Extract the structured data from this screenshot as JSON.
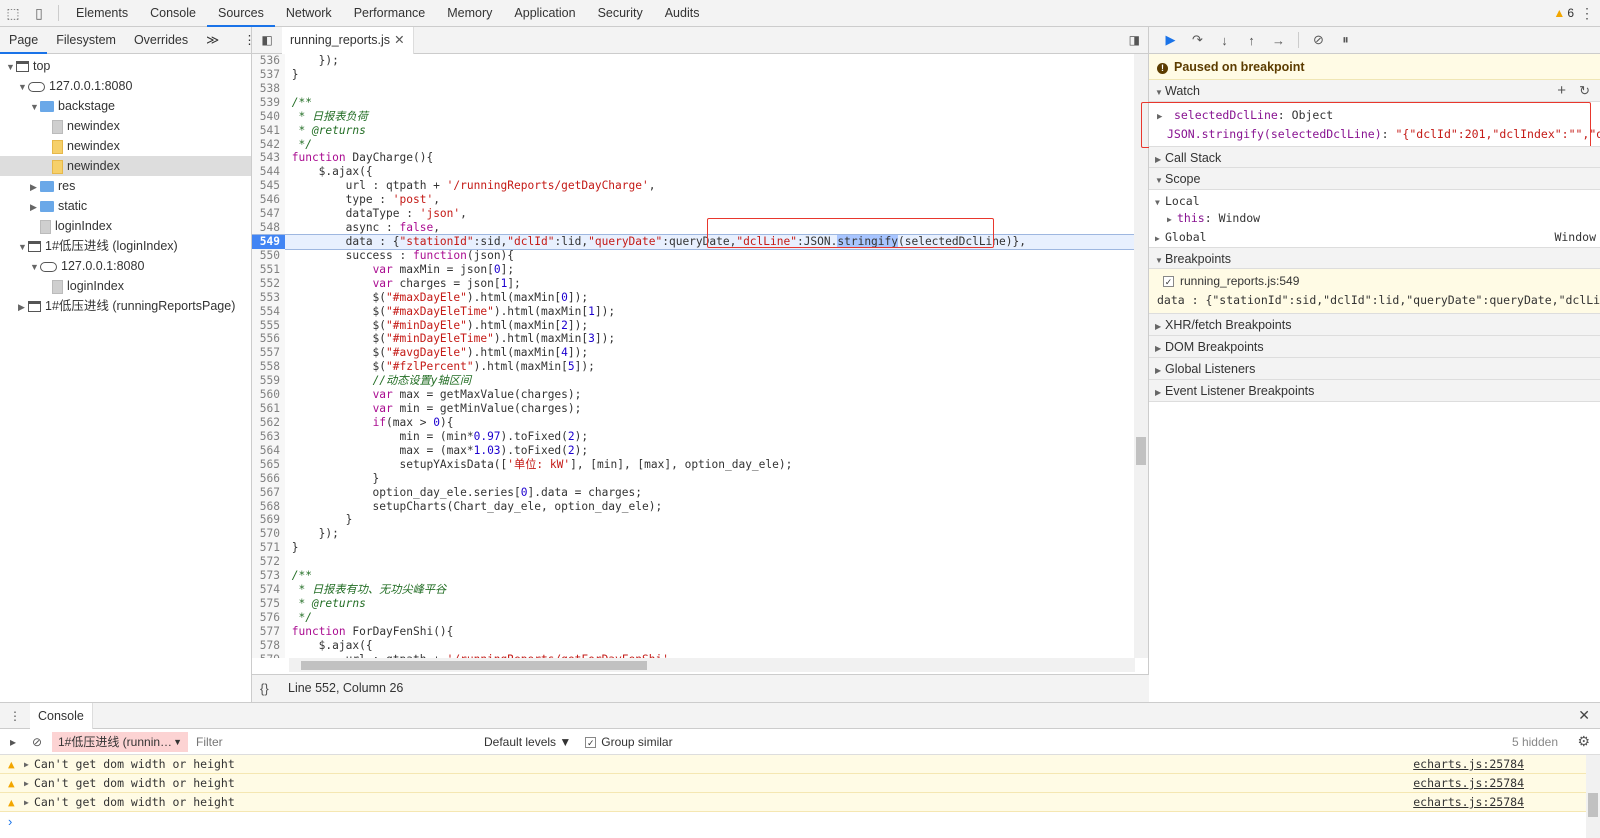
{
  "toolbar": {
    "tabs": [
      "Elements",
      "Console",
      "Sources",
      "Network",
      "Performance",
      "Memory",
      "Application",
      "Security",
      "Audits"
    ],
    "active_tab": "Sources",
    "warning_count": "6",
    "colors": {
      "accent": "#1a73e8",
      "warning": "#f2a600",
      "highlight_box": "#e8372d"
    }
  },
  "navigator": {
    "tabs": [
      "Page",
      "Filesystem",
      "Overrides"
    ],
    "more": "≫",
    "tree": [
      {
        "label": "top",
        "icon": "frame-icon",
        "depth": 0,
        "open": true
      },
      {
        "label": "127.0.0.1:8080",
        "icon": "cloud-icon",
        "depth": 1,
        "open": true
      },
      {
        "label": "backstage",
        "icon": "folder-icon",
        "depth": 2,
        "open": true
      },
      {
        "label": "newindex",
        "icon": "file-icon",
        "depth": 3
      },
      {
        "label": "newindex",
        "icon": "js-file-icon",
        "depth": 3
      },
      {
        "label": "newindex",
        "icon": "js-file-icon",
        "depth": 3,
        "selected": true
      },
      {
        "label": "res",
        "icon": "folder-icon",
        "depth": 2,
        "open": false
      },
      {
        "label": "static",
        "icon": "folder-icon",
        "depth": 2,
        "open": false
      },
      {
        "label": "loginIndex",
        "icon": "file-icon",
        "depth": 2
      },
      {
        "label": "1#低压进线 (loginIndex)",
        "icon": "frame-icon",
        "depth": 1,
        "open": true
      },
      {
        "label": "127.0.0.1:8080",
        "icon": "cloud-icon",
        "depth": 2,
        "open": true
      },
      {
        "label": "loginIndex",
        "icon": "file-icon",
        "depth": 3
      },
      {
        "label": "1#低压进线 (runningReportsPage)",
        "icon": "frame-icon",
        "depth": 1,
        "open": false
      }
    ]
  },
  "editor": {
    "file_tab": "running_reports.js",
    "status": "Line 552, Column 26",
    "format_button": "{}",
    "breakpoint_line": 549,
    "lines": [
      {
        "n": 536,
        "h": "    });"
      },
      {
        "n": 537,
        "h": "}"
      },
      {
        "n": 538,
        "h": ""
      },
      {
        "n": 539,
        "h": "<span class=\"cm\">/**</span>"
      },
      {
        "n": 540,
        "h": "<span class=\"cm\"> * 日报表负荷</span>"
      },
      {
        "n": 541,
        "h": "<span class=\"cm\"> * @returns</span>"
      },
      {
        "n": 542,
        "h": "<span class=\"cm\"> */</span>"
      },
      {
        "n": 543,
        "h": "<span class=\"kw\">function</span> DayCharge(){"
      },
      {
        "n": 544,
        "h": "    $.ajax({"
      },
      {
        "n": 545,
        "h": "        url : qtpath + <span class=\"str\">'/runningReports/getDayCharge'</span>,"
      },
      {
        "n": 546,
        "h": "        type : <span class=\"str\">'post'</span>,"
      },
      {
        "n": 547,
        "h": "        dataType : <span class=\"str\">'json'</span>,"
      },
      {
        "n": 548,
        "h": "        async : <span class=\"kw\">false</span>,"
      },
      {
        "n": 549,
        "h": "        data : {<span class=\"str\">\"stationId\"</span>:sid,<span class=\"str\">\"dclId\"</span>:lid,<span class=\"str\">\"queryDate\"</span>:queryDate,<span class=\"str\">\"dclLine\"</span>:JSON.<span class=\"hl\">stringify</span>(selectedDclLine)},"
      },
      {
        "n": 550,
        "h": "        success : <span class=\"kw\">function</span>(json){"
      },
      {
        "n": 551,
        "h": "            <span class=\"kw\">var</span> maxMin = json[<span class=\"num\">0</span>];"
      },
      {
        "n": 552,
        "h": "            <span class=\"kw\">var</span> charges = json[<span class=\"num\">1</span>];"
      },
      {
        "n": 553,
        "h": "            $(<span class=\"str\">\"#maxDayEle\"</span>).html(maxMin[<span class=\"num\">0</span>]);"
      },
      {
        "n": 554,
        "h": "            $(<span class=\"str\">\"#maxDayEleTime\"</span>).html(maxMin[<span class=\"num\">1</span>]);"
      },
      {
        "n": 555,
        "h": "            $(<span class=\"str\">\"#minDayEle\"</span>).html(maxMin[<span class=\"num\">2</span>]);"
      },
      {
        "n": 556,
        "h": "            $(<span class=\"str\">\"#minDayEleTime\"</span>).html(maxMin[<span class=\"num\">3</span>]);"
      },
      {
        "n": 557,
        "h": "            $(<span class=\"str\">\"#avgDayEle\"</span>).html(maxMin[<span class=\"num\">4</span>]);"
      },
      {
        "n": 558,
        "h": "            $(<span class=\"str\">\"#fzlPercent\"</span>).html(maxMin[<span class=\"num\">5</span>]);"
      },
      {
        "n": 559,
        "h": "            <span class=\"cm\">//动态设置y轴区间</span>"
      },
      {
        "n": 560,
        "h": "            <span class=\"kw\">var</span> max = getMaxValue(charges);"
      },
      {
        "n": 561,
        "h": "            <span class=\"kw\">var</span> min = getMinValue(charges);"
      },
      {
        "n": 562,
        "h": "            <span class=\"kw\">if</span>(max &gt; <span class=\"num\">0</span>){"
      },
      {
        "n": 563,
        "h": "                min = (min*<span class=\"num\">0.97</span>).toFixed(<span class=\"num\">2</span>);"
      },
      {
        "n": 564,
        "h": "                max = (max*<span class=\"num\">1.03</span>).toFixed(<span class=\"num\">2</span>);"
      },
      {
        "n": 565,
        "h": "                setupYAxisData([<span class=\"str\">'单位: kW'</span>], [min], [max], option_day_ele);"
      },
      {
        "n": 566,
        "h": "            }"
      },
      {
        "n": 567,
        "h": "            option_day_ele.series[<span class=\"num\">0</span>].data = charges;"
      },
      {
        "n": 568,
        "h": "            setupCharts(Chart_day_ele, option_day_ele);"
      },
      {
        "n": 569,
        "h": "        }"
      },
      {
        "n": 570,
        "h": "    });"
      },
      {
        "n": 571,
        "h": "}"
      },
      {
        "n": 572,
        "h": ""
      },
      {
        "n": 573,
        "h": "<span class=\"cm\">/**</span>"
      },
      {
        "n": 574,
        "h": "<span class=\"cm\"> * 日报表有功、无功尖峰平谷</span>"
      },
      {
        "n": 575,
        "h": "<span class=\"cm\"> * @returns</span>"
      },
      {
        "n": 576,
        "h": "<span class=\"cm\"> */</span>"
      },
      {
        "n": 577,
        "h": "<span class=\"kw\">function</span> ForDayFenShi(){"
      },
      {
        "n": 578,
        "h": "    $.ajax({"
      },
      {
        "n": 579,
        "h": "        url : qtpath + <span class=\"str\">'/runningReports/getForDayFenShi'</span>,"
      },
      {
        "n": 580,
        "h": ""
      }
    ]
  },
  "debugger": {
    "paused_text": "Paused on breakpoint",
    "watch": {
      "title": "Watch",
      "items": [
        {
          "name": "selectedDclLine",
          "value": "Object"
        },
        {
          "name": "JSON.stringify(selectedDclLine)",
          "value": "\"{\"dclId\":201,\"dclIndex\":\"\",\"d…"
        }
      ]
    },
    "call_stack": "Call Stack",
    "scope": {
      "title": "Scope",
      "local": "Local",
      "this_key": "this",
      "this_val": "Window",
      "global": "Global",
      "global_val": "Window"
    },
    "breakpoints": {
      "title": "Breakpoints",
      "file": "running_reports.js:549",
      "code": "data : {\"stationId\":sid,\"dclId\":lid,\"queryDate\":queryDate,\"dclLi…"
    },
    "sections": [
      "XHR/fetch Breakpoints",
      "DOM Breakpoints",
      "Global Listeners",
      "Event Listener Breakpoints"
    ]
  },
  "console": {
    "tab": "Console",
    "context": "1#低压进线 (runnin…",
    "filter_placeholder": "Filter",
    "levels": "Default levels ▼",
    "group_similar": "Group similar",
    "hidden": "5 hidden",
    "messages": [
      {
        "text": "Can't get dom width or height",
        "src": "echarts.js:25784"
      },
      {
        "text": "Can't get dom width or height",
        "src": "echarts.js:25784"
      },
      {
        "text": "Can't get dom width or height",
        "src": "echarts.js:25784"
      }
    ],
    "prompt": "›"
  }
}
